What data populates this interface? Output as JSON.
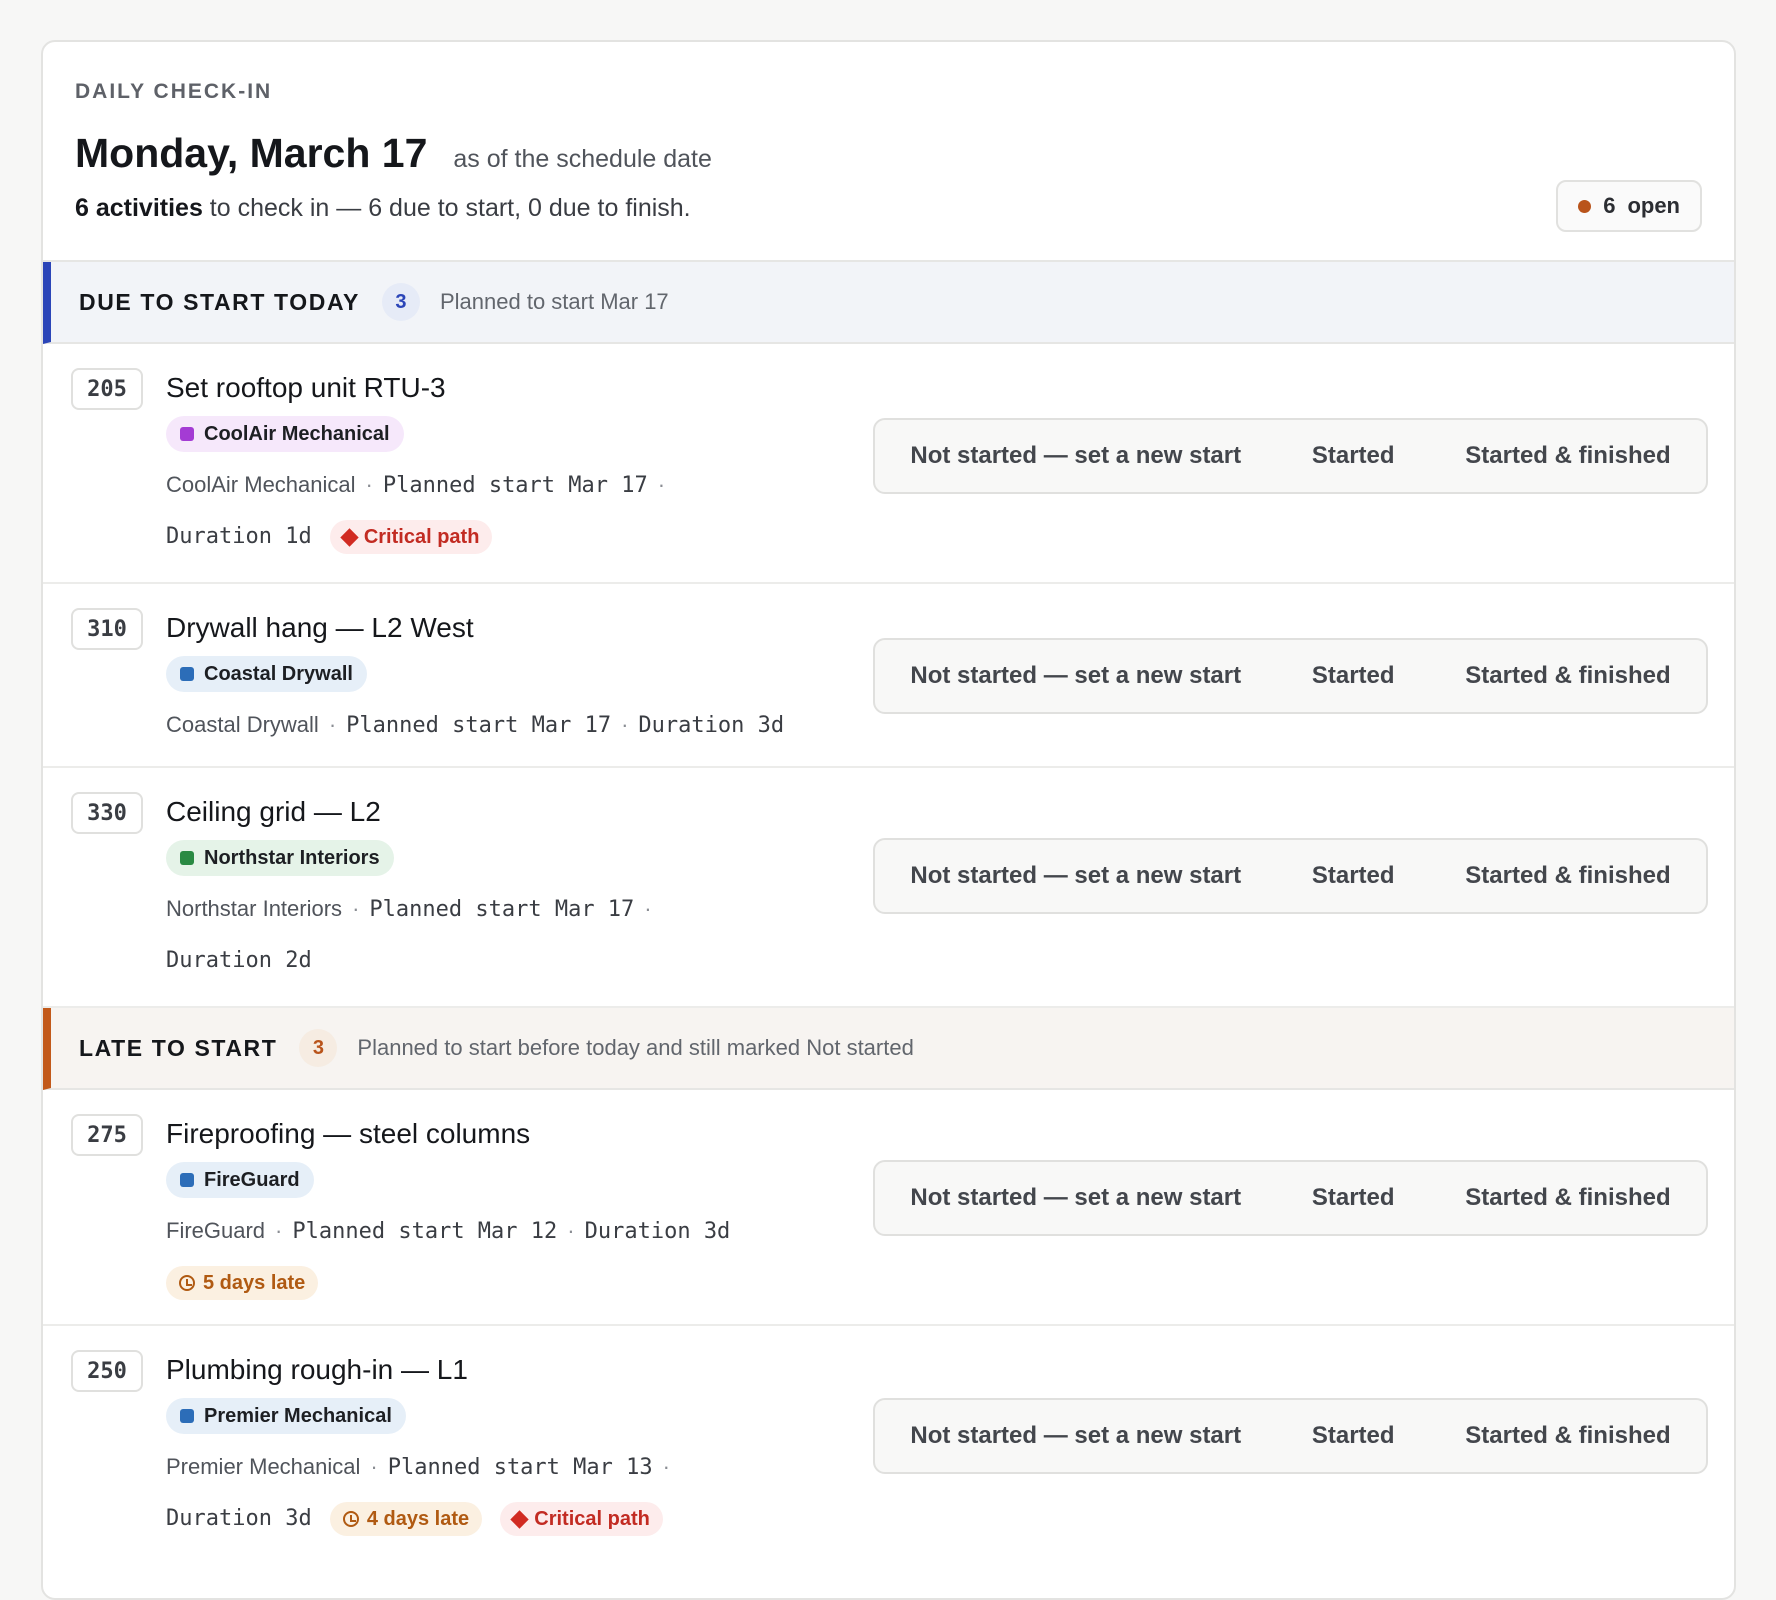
{
  "header": {
    "eyebrow": "DAILY CHECK-IN",
    "date": "Monday, March 17",
    "date_note": "as of the schedule date",
    "summary_bold": "6 activities",
    "summary_rest": " to check in — 6 due to start, 0 due to finish.",
    "open_count": "6",
    "open_label": "open"
  },
  "colors": {
    "due_accent": "#2b45b8",
    "late_accent": "#c2591a",
    "critical": "#c22b22"
  },
  "actions": {
    "not_started": "Not started — set a new start",
    "started": "Started",
    "started_finished": "Started & finished"
  },
  "labels": {
    "critical_path": "Critical path",
    "sep": "·"
  },
  "sections": [
    {
      "title": "DUE TO START TODAY",
      "count": "3",
      "desc": "Planned to start Mar 17",
      "rows": [
        {
          "id": "205",
          "title": "Set rooftop unit RTU-3",
          "firm": "CoolAir Mechanical",
          "firm_color": "#a43bd4",
          "firm_bg": "#f6e8fb",
          "planned": "Planned start Mar 17",
          "duration": "Duration 1d",
          "critical": true
        },
        {
          "id": "310",
          "title": "Drywall hang — L2 West",
          "firm": "Coastal Drywall",
          "firm_color": "#2c6db8",
          "firm_bg": "#e6eff8",
          "planned": "Planned start Mar 17",
          "duration": "Duration 3d",
          "critical": false
        },
        {
          "id": "330",
          "title": "Ceiling grid — L2",
          "firm": "Northstar Interiors",
          "firm_color": "#2a8a43",
          "firm_bg": "#e5f3e8",
          "planned": "Planned start Mar 17",
          "duration": "Duration 2d",
          "critical": false
        }
      ]
    },
    {
      "title": "LATE TO START",
      "count": "3",
      "desc": "Planned to start before today and still marked Not started",
      "rows": [
        {
          "id": "275",
          "title": "Fireproofing — steel columns",
          "firm": "FireGuard",
          "firm_color": "#2c6db8",
          "firm_bg": "#e6eff8",
          "planned": "Planned start Mar 12",
          "duration": "Duration 3d",
          "late": "5 days late",
          "critical": false
        },
        {
          "id": "250",
          "title": "Plumbing rough-in — L1",
          "firm": "Premier Mechanical",
          "firm_color": "#2c6db8",
          "firm_bg": "#e6eff8",
          "planned": "Planned start Mar 13",
          "duration": "Duration 3d",
          "late": "4 days late",
          "critical": true
        }
      ]
    }
  ]
}
